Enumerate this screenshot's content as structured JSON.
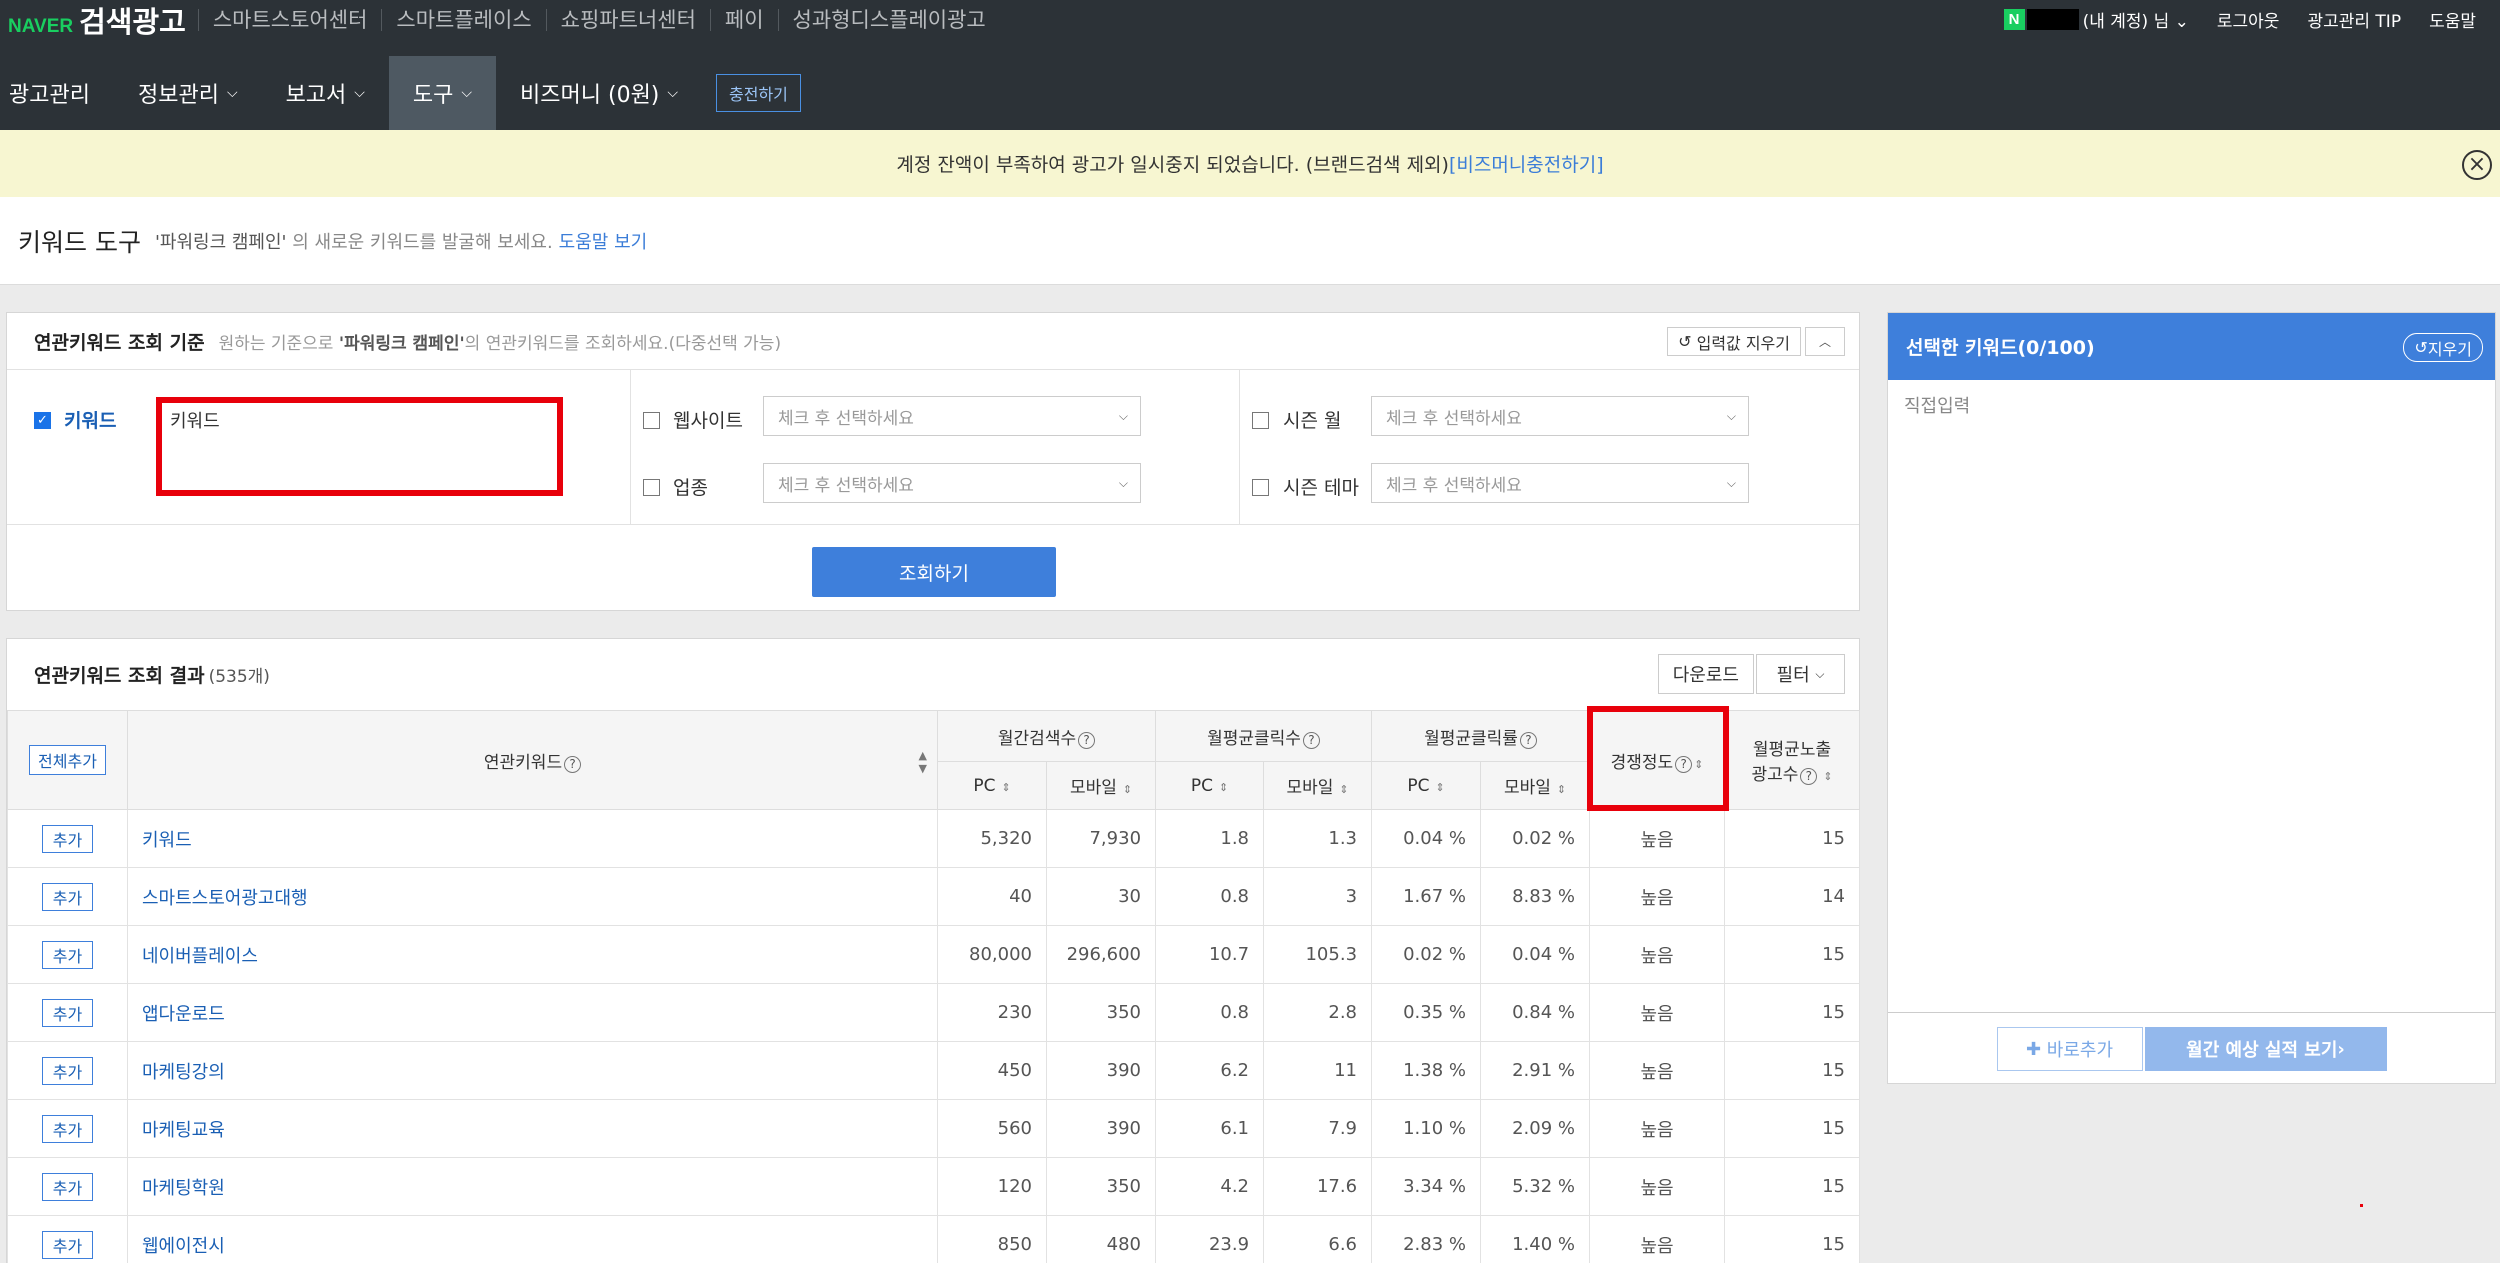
{
  "brand": {
    "naver": "NAVER",
    "product": "검색광고"
  },
  "gnb": [
    "스마트스토어센터",
    "스마트플레이스",
    "쇼핑파트너센터",
    "페이",
    "성과형디스플레이광고"
  ],
  "account": {
    "badge": "N",
    "account_label": "(내 계정) 님",
    "logout": "로그아웃",
    "tip": "광고관리 TIP",
    "help": "도움말"
  },
  "subnav": {
    "items": [
      "광고관리",
      "정보관리",
      "보고서",
      "도구",
      "비즈머니 (0원)"
    ],
    "charge": "충전하기"
  },
  "alert": {
    "text": "계정 잔액이 부족하여 광고가 일시중지 되었습니다. (브랜드검색 제외)",
    "link": "[비즈머니충전하기]"
  },
  "page": {
    "title": "키워드 도구",
    "desc_campaign": "'파워링크 캠페인'",
    "desc_rest": " 의 새로운 키워드를 발굴해 보세요.",
    "help_link": "도움말 보기"
  },
  "criteria": {
    "title": "연관키워드 조회 기준",
    "desc_prefix": "원하는 기준으로 ",
    "desc_campaign": "'파워링크 캠페인'",
    "desc_suffix": "의 연관키워드를 조회하세요.(다중선택 가능)",
    "reset": "입력값 지우기",
    "keyword_label": "키워드",
    "keyword_value": "키워드",
    "website_label": "웹사이트",
    "industry_label": "업종",
    "season_month_label": "시즌 월",
    "season_theme_label": "시즌 테마",
    "select_placeholder": "체크 후 선택하세요",
    "search_button": "조회하기"
  },
  "side": {
    "title": "선택한 키워드(0/100)",
    "reset": "지우기",
    "placeholder": "직접입력",
    "add_now": "바로추가",
    "forecast": "월간 예상 실적 보기"
  },
  "results": {
    "title": "연관키워드 조회 결과",
    "count": "(535개)",
    "download": "다운로드",
    "filter": "필터",
    "add_all": "전체추가",
    "headers": {
      "keyword": "연관키워드",
      "monthly_search": "월간검색수",
      "avg_clicks": "월평균클릭수",
      "avg_ctr": "월평균클릭률",
      "competition": "경쟁정도",
      "ad_impressions_1": "월평균노출",
      "ad_impressions_2": "광고수",
      "pc": "PC",
      "mobile": "모바일"
    },
    "add_label": "추가",
    "rows": [
      {
        "keyword": "키워드",
        "search_pc": "5,320",
        "search_mobile": "7,930",
        "click_pc": "1.8",
        "click_mobile": "1.3",
        "ctr_pc": "0.04 %",
        "ctr_mobile": "0.02 %",
        "competition": "높음",
        "ads": "15"
      },
      {
        "keyword": "스마트스토어광고대행",
        "search_pc": "40",
        "search_mobile": "30",
        "click_pc": "0.8",
        "click_mobile": "3",
        "ctr_pc": "1.67 %",
        "ctr_mobile": "8.83 %",
        "competition": "높음",
        "ads": "14"
      },
      {
        "keyword": "네이버플레이스",
        "search_pc": "80,000",
        "search_mobile": "296,600",
        "click_pc": "10.7",
        "click_mobile": "105.3",
        "ctr_pc": "0.02 %",
        "ctr_mobile": "0.04 %",
        "competition": "높음",
        "ads": "15"
      },
      {
        "keyword": "앱다운로드",
        "search_pc": "230",
        "search_mobile": "350",
        "click_pc": "0.8",
        "click_mobile": "2.8",
        "ctr_pc": "0.35 %",
        "ctr_mobile": "0.84 %",
        "competition": "높음",
        "ads": "15"
      },
      {
        "keyword": "마케팅강의",
        "search_pc": "450",
        "search_mobile": "390",
        "click_pc": "6.2",
        "click_mobile": "11",
        "ctr_pc": "1.38 %",
        "ctr_mobile": "2.91 %",
        "competition": "높음",
        "ads": "15"
      },
      {
        "keyword": "마케팅교육",
        "search_pc": "560",
        "search_mobile": "390",
        "click_pc": "6.1",
        "click_mobile": "7.9",
        "ctr_pc": "1.10 %",
        "ctr_mobile": "2.09 %",
        "competition": "높음",
        "ads": "15"
      },
      {
        "keyword": "마케팅학원",
        "search_pc": "120",
        "search_mobile": "350",
        "click_pc": "4.2",
        "click_mobile": "17.6",
        "ctr_pc": "3.34 %",
        "ctr_mobile": "5.32 %",
        "competition": "높음",
        "ads": "15"
      },
      {
        "keyword": "웹에이전시",
        "search_pc": "850",
        "search_mobile": "480",
        "click_pc": "23.9",
        "click_mobile": "6.6",
        "ctr_pc": "2.83 %",
        "ctr_mobile": "1.40 %",
        "competition": "높음",
        "ads": "15"
      }
    ]
  }
}
